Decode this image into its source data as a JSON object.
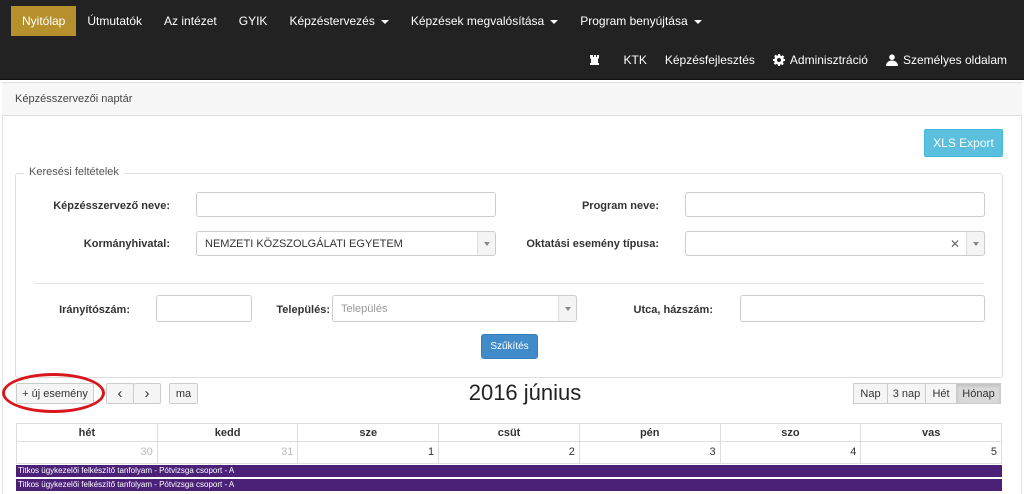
{
  "nav": {
    "row1": [
      {
        "label": "Nyitólap",
        "active": true
      },
      {
        "label": "Útmutatók"
      },
      {
        "label": "Az intézet"
      },
      {
        "label": "GYIK"
      },
      {
        "label": "Képzéstervezés",
        "dropdown": true
      },
      {
        "label": "Képzések megvalósítása",
        "dropdown": true
      },
      {
        "label": "Program benyújtása",
        "dropdown": true
      }
    ],
    "row2": {
      "ktk": "KTK",
      "kepzesfejlesztes": "Képzésfejlesztés",
      "admin": "Adminisztráció",
      "personal": "Személyes oldalam"
    }
  },
  "page": {
    "title": "Képzésszervezői naptár",
    "xls_export": "XLS Export"
  },
  "search": {
    "legend": "Keresési feltételek",
    "organizer_label": "Képzésszervező neve:",
    "organizer_value": "",
    "program_label": "Program neve:",
    "program_value": "",
    "office_label": "Kormányhivatal:",
    "office_value": "NEMZETI KÖZSZOLGÁLATI EGYETEM",
    "event_type_label": "Oktatási esemény típusa:",
    "event_type_value": "",
    "zip_label": "Irányítószám:",
    "zip_value": "",
    "city_label": "Település:",
    "city_placeholder": "Település",
    "street_label": "Utca, házszám:",
    "street_value": "",
    "filter_button": "Szűkítés"
  },
  "calendar": {
    "new_event": "+ új esemény",
    "prev": "‹",
    "next": "›",
    "today": "ma",
    "title": "2016 június",
    "views": [
      "Nap",
      "3 nap",
      "Hét",
      "Hónap"
    ],
    "active_view": "Hónap",
    "weekdays": [
      "hét",
      "kedd",
      "sze",
      "csüt",
      "pén",
      "szo",
      "vas"
    ],
    "week1": [
      {
        "day": "30",
        "other_month": true
      },
      {
        "day": "31",
        "other_month": true
      },
      {
        "day": "1"
      },
      {
        "day": "2"
      },
      {
        "day": "3"
      },
      {
        "day": "4"
      },
      {
        "day": "5"
      }
    ],
    "events": [
      "Titkos ügykezelői felkészítő tanfolyam - Pótvizsga csoport - A",
      "Titkos ügykezelői felkészítő tanfolyam - Pótvizsga csoport - A"
    ],
    "event_color": "#4b2178"
  }
}
